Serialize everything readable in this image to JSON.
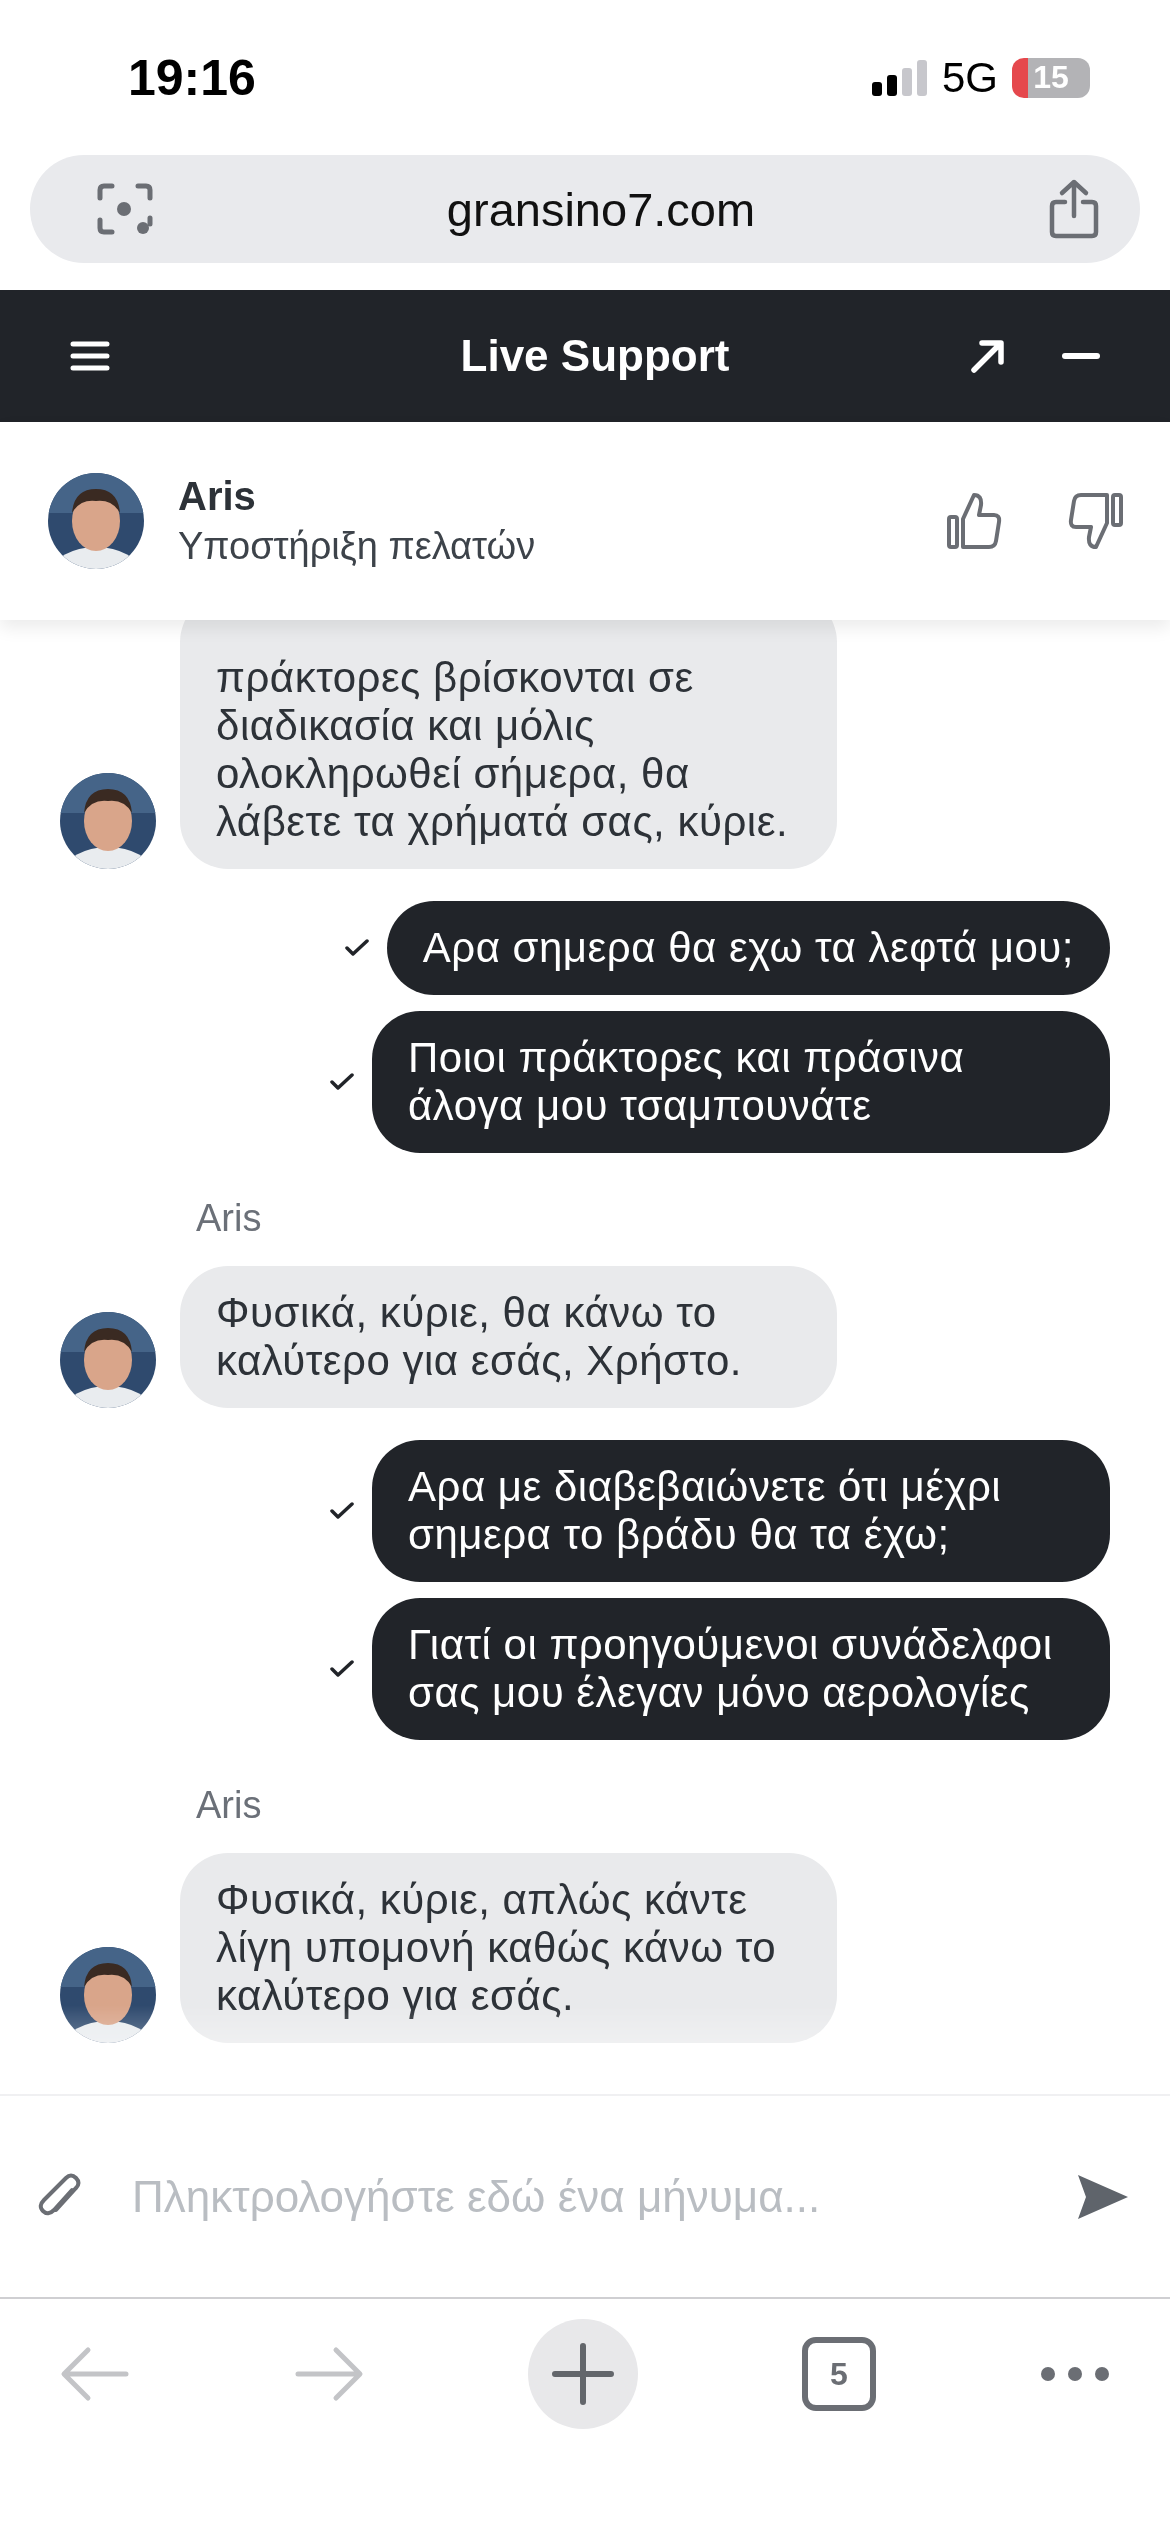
{
  "status_bar": {
    "time": "19:16",
    "network": "5G",
    "battery": "15"
  },
  "browser": {
    "url": "gransino7.com",
    "tab_count": "5"
  },
  "widget": {
    "title": "Live Support"
  },
  "agent": {
    "name": "Aris",
    "role": "Υποστήριξη πελατών"
  },
  "messages": [
    {
      "kind": "agent",
      "text": "πράκτορες βρίσκονται σε διαδικασία και μόλις ολοκληρωθεί σήμερα, θα λάβετε τα χρήματά σας, κύριε."
    },
    {
      "kind": "user",
      "text": "Αρα σημερα θα εχω τα λεφτά μου;",
      "delivered": true
    },
    {
      "kind": "user",
      "text": "Ποιοι πράκτορες και πράσινα άλογα μου τσαμπουνάτε",
      "delivered": true
    },
    {
      "kind": "agent",
      "sender": "Aris",
      "text": "Φυσικά, κύριε, θα κάνω το καλύτερο για εσάς, Χρήστο."
    },
    {
      "kind": "user",
      "text": "Αρα με διαβεβαιώνετε ότι μέχρι σημερα το βράδυ θα τα έχω;",
      "delivered": true
    },
    {
      "kind": "user",
      "text": "Γιατί οι προηγούμενοι συνάδελφοι σας μου έλεγαν μόνο αερολογίες",
      "delivered": true
    },
    {
      "kind": "agent",
      "sender": "Aris",
      "text": "Φυσικά, κύριε, απλώς κάντε λίγη υπομονή καθώς κάνω το καλύτερο για εσάς."
    }
  ],
  "composer": {
    "placeholder": "Πληκτρολογήστε εδώ ένα μήνυμα..."
  }
}
